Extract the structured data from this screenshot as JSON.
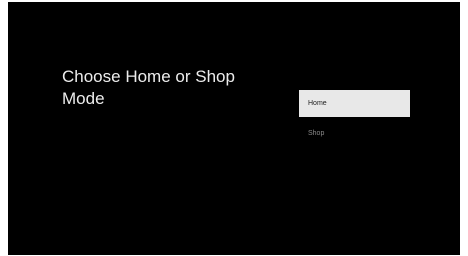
{
  "screen": {
    "title": "Choose Home or Shop Mode"
  },
  "options": [
    {
      "label": "Home",
      "focused": true
    },
    {
      "label": "Shop",
      "focused": false
    }
  ],
  "colors": {
    "background": "#000000",
    "focused_option_bg": "#e8e8e8",
    "title_text": "#ececec",
    "unfocused_option_text": "#8a8a8a"
  }
}
